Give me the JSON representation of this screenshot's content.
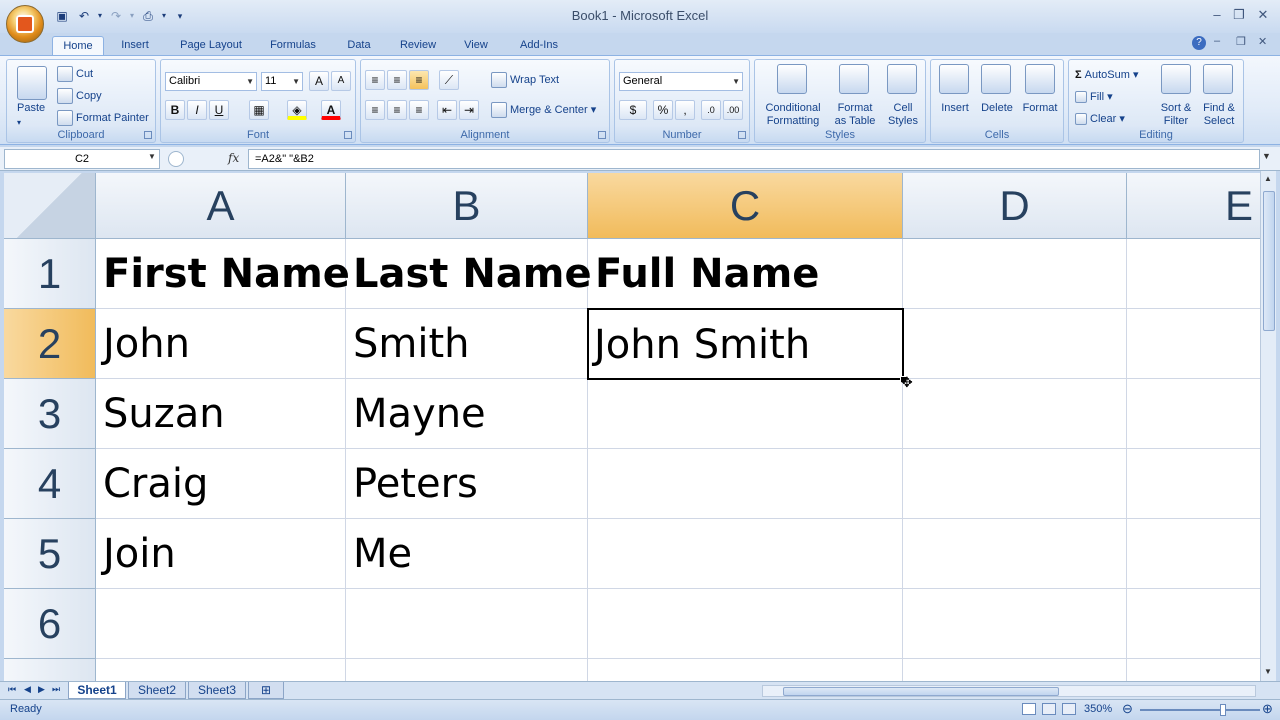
{
  "window": {
    "title": "Book1 - Microsoft Excel"
  },
  "tabs": [
    "Home",
    "Insert",
    "Page Layout",
    "Formulas",
    "Data",
    "Review",
    "View",
    "Add-Ins"
  ],
  "active_tab": "Home",
  "ribbon": {
    "clipboard": {
      "label": "Clipboard",
      "paste": "Paste",
      "cut": "Cut",
      "copy": "Copy",
      "format_painter": "Format Painter"
    },
    "font": {
      "label": "Font",
      "family": "Calibri",
      "size": "11",
      "bold": "B",
      "italic": "I",
      "underline": "U"
    },
    "alignment": {
      "label": "Alignment",
      "wrap_text": "Wrap Text",
      "merge_center": "Merge & Center"
    },
    "number": {
      "label": "Number",
      "format": "General",
      "percent": "%",
      "comma": ","
    },
    "styles": {
      "label": "Styles",
      "conditional": "Conditional",
      "formatting": "Formatting",
      "format": "Format",
      "as_table": "as Table",
      "cell": "Cell",
      "cell_styles": "Styles"
    },
    "cells": {
      "label": "Cells",
      "insert": "Insert",
      "delete": "Delete",
      "format": "Format"
    },
    "editing": {
      "label": "Editing",
      "autosum": "AutoSum",
      "fill": "Fill",
      "clear": "Clear",
      "sort": "Sort &",
      "filter": "Filter",
      "find": "Find &",
      "select": "Select"
    }
  },
  "formula_bar": {
    "name_box": "C2",
    "fx": "fx",
    "formula": "=A2&\" \"&B2"
  },
  "columns": [
    "A",
    "B",
    "C",
    "D",
    "E"
  ],
  "rows": [
    "1",
    "2",
    "3",
    "4",
    "5",
    "6"
  ],
  "cells": {
    "A1": "First Name",
    "B1": "Last Name",
    "C1": "Full Name",
    "A2": "John",
    "B2": "Smith",
    "C2": "John Smith",
    "A3": "Suzan",
    "B3": "Mayne",
    "A4": "Craig",
    "B4": "Peters",
    "A5": "Join",
    "B5": "Me"
  },
  "sheets": [
    "Sheet1",
    "Sheet2",
    "Sheet3"
  ],
  "active_sheet": "Sheet1",
  "status": {
    "ready": "Ready",
    "zoom": "350%"
  },
  "colors": {
    "accent": "#f1bb5b",
    "ribbon": "#dde8f6",
    "grid_line": "#d0d7e5",
    "header_text": "#27415f"
  }
}
